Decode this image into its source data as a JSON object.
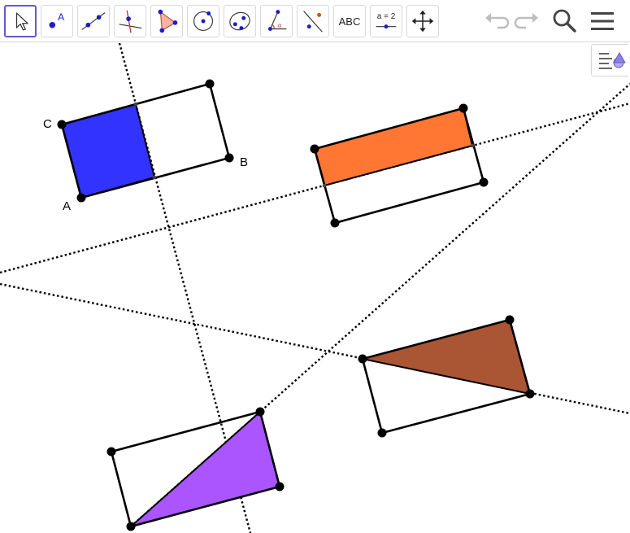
{
  "toolbar": {
    "tools": [
      {
        "name": "move-tool",
        "active": true
      },
      {
        "name": "point-tool"
      },
      {
        "name": "line-tool"
      },
      {
        "name": "perpendicular-line-tool"
      },
      {
        "name": "polygon-tool"
      },
      {
        "name": "circle-tool"
      },
      {
        "name": "conic-tool"
      },
      {
        "name": "angle-tool"
      },
      {
        "name": "reflect-tool"
      },
      {
        "name": "text-tool",
        "label": "ABC"
      },
      {
        "name": "slider-tool",
        "label": "a = 2"
      },
      {
        "name": "move-graphics-view-tool"
      }
    ],
    "point_tool_letter": "A",
    "right_buttons": [
      "undo-icon",
      "redo-icon",
      "search-icon",
      "menu-icon"
    ]
  },
  "style_bar_toggle": {
    "icon": "style-bar-icon"
  },
  "canvas": {
    "point_labels": {
      "a": "A",
      "b": "B",
      "c": "C"
    },
    "colors": {
      "blue_fill": "#3333ff",
      "orange_fill": "#ff7733",
      "brown_fill": "#aa5533",
      "purple_fill": "#aa55ff",
      "stroke": "#000000",
      "accent": "#6557d2"
    }
  }
}
